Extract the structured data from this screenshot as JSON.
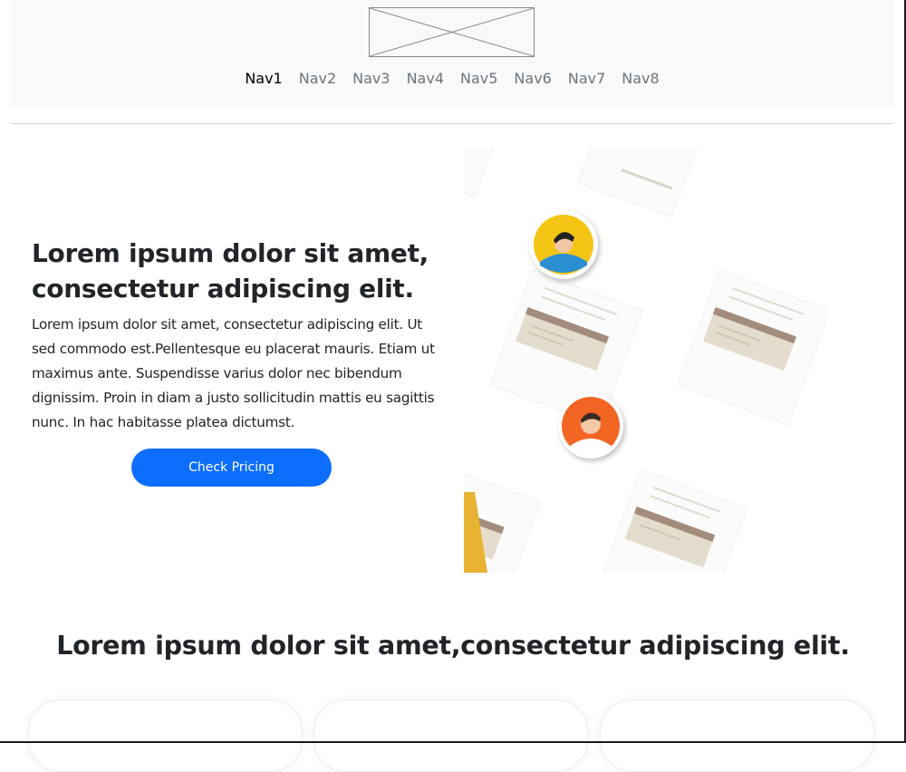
{
  "header": {
    "logo_icon": "image-placeholder-icon",
    "nav": [
      {
        "label": "Nav1",
        "active": true
      },
      {
        "label": "Nav2",
        "active": false
      },
      {
        "label": "Nav3",
        "active": false
      },
      {
        "label": "Nav4",
        "active": false
      },
      {
        "label": "Nav5",
        "active": false
      },
      {
        "label": "Nav6",
        "active": false
      },
      {
        "label": "Nav7",
        "active": false
      },
      {
        "label": "Nav8",
        "active": false
      }
    ]
  },
  "hero": {
    "title": "Lorem ipsum dolor sit amet, consectetur adipiscing elit.",
    "text": "Lorem ipsum dolor sit amet, consectetur adipiscing elit. Ut sed commodo est.Pellentesque eu placerat mauris. Etiam ut maximus ante. Suspendisse varius dolor nec bibendum dignissim. Proin in diam a justo sollicitudin mattis eu sagittis nunc. In hac habitasse platea dictumst.",
    "button_label": "Check Pricing",
    "illustration_icon": "documents-avatars-illustration"
  },
  "section": {
    "title": "Lorem ipsum dolor sit amet,consectetur adipiscing elit."
  },
  "colors": {
    "accent": "#0d6efd",
    "header_bg": "#f8f9fa",
    "avatar_yellow": "#f5c518",
    "avatar_orange": "#f26522"
  }
}
